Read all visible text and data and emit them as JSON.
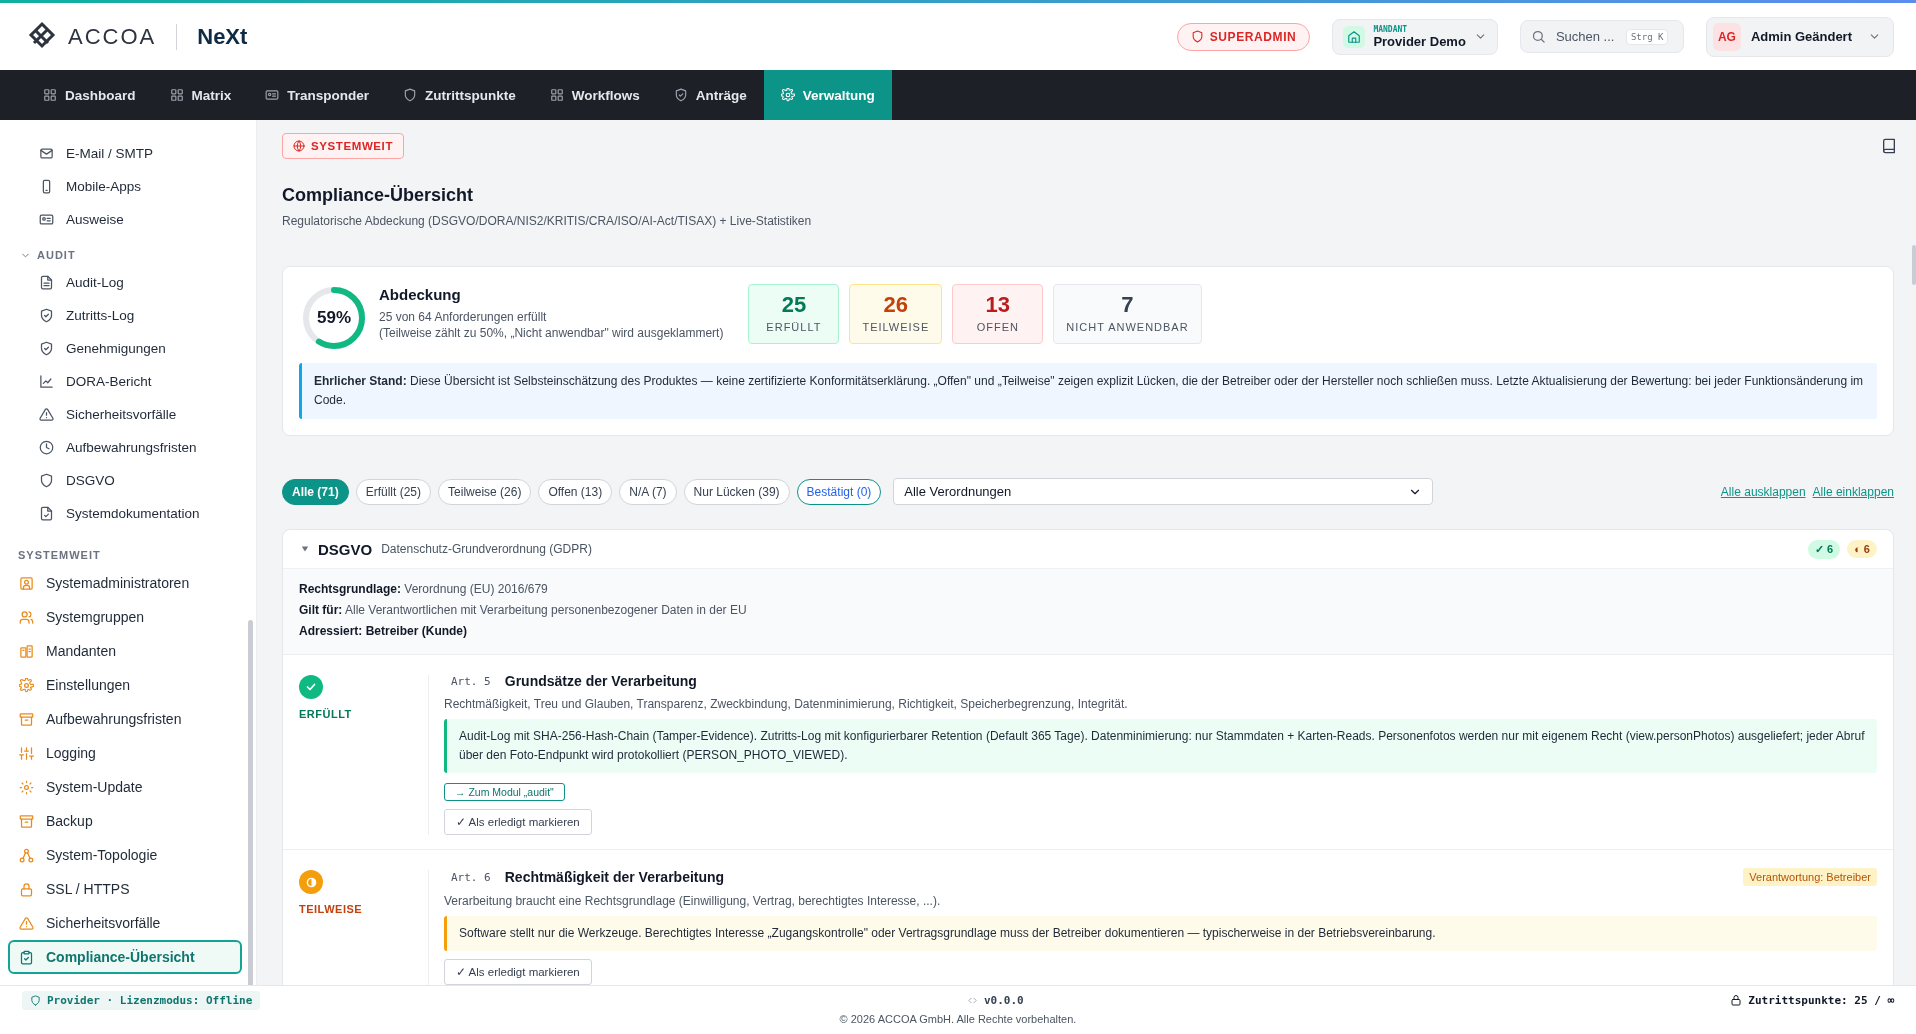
{
  "header": {
    "logo": "ACCOA",
    "product": "NeXt",
    "role_badge": "SUPERADMIN",
    "tenant": {
      "label": "MANDANT",
      "value": "Provider Demo"
    },
    "search": {
      "placeholder": "Suchen ...",
      "shortcut": "Strg K"
    },
    "user": {
      "initials": "AG",
      "name": "Admin Geändert"
    }
  },
  "nav": [
    {
      "label": "Dashboard",
      "selected": false
    },
    {
      "label": "Matrix",
      "selected": false
    },
    {
      "label": "Transponder",
      "selected": false
    },
    {
      "label": "Zutrittspunkte",
      "selected": false
    },
    {
      "label": "Workflows",
      "selected": false
    },
    {
      "label": "Anträge",
      "selected": false
    },
    {
      "label": "Verwaltung",
      "selected": true
    }
  ],
  "sidebar": {
    "groups": [
      {
        "items": [
          {
            "label": "E-Mail / SMTP",
            "selected": false
          },
          {
            "label": "Mobile-Apps",
            "selected": false
          },
          {
            "label": "Ausweise",
            "selected": false
          }
        ]
      },
      {
        "title": "AUDIT",
        "expanded": true,
        "items": [
          {
            "label": "Audit-Log",
            "selected": false
          },
          {
            "label": "Zutritts-Log",
            "selected": false
          },
          {
            "label": "Genehmigungen",
            "selected": false
          },
          {
            "label": "DORA-Bericht",
            "selected": false
          },
          {
            "label": "Sicherheitsvorfälle",
            "selected": false
          },
          {
            "label": "Aufbewahrungsfristen",
            "selected": false
          },
          {
            "label": "DSGVO",
            "selected": false
          },
          {
            "label": "Systemdokumentation",
            "selected": false
          }
        ]
      },
      {
        "title": "SYSTEMWEIT",
        "kind": "system",
        "items": [
          {
            "label": "Systemadministratoren",
            "selected": false
          },
          {
            "label": "Systemgruppen",
            "selected": false
          },
          {
            "label": "Mandanten",
            "selected": false
          },
          {
            "label": "Einstellungen",
            "selected": false
          },
          {
            "label": "Aufbewahrungsfristen",
            "selected": false
          },
          {
            "label": "Logging",
            "selected": false
          },
          {
            "label": "System-Update",
            "selected": false
          },
          {
            "label": "Backup",
            "selected": false
          },
          {
            "label": "System-Topologie",
            "selected": false
          },
          {
            "label": "SSL / HTTPS",
            "selected": false
          },
          {
            "label": "Sicherheitsvorfälle",
            "selected": false
          },
          {
            "label": "Compliance-Übersicht",
            "selected": true
          }
        ]
      }
    ]
  },
  "page": {
    "scope_badge": "SYSTEMWEIT",
    "title": "Compliance-Übersicht",
    "subtitle": "Regulatorische Abdeckung (DSGVO/DORA/NIS2/KRITIS/CRA/ISO/AI-Act/TISAX) + Live-Statistiken"
  },
  "coverage": {
    "percent": "59%",
    "level": 0.59,
    "title": "Abdeckung",
    "line1": "25 von 64 Anforderungen erfüllt",
    "line2": "(Teilweise zählt zu 50%, „Nicht anwendbar\" wird ausgeklammert)",
    "stats": [
      {
        "kind": "fulfilled",
        "value": "25",
        "label": "ERFÜLLT"
      },
      {
        "kind": "partial",
        "value": "26",
        "label": "TEILWEISE"
      },
      {
        "kind": "open",
        "value": "13",
        "label": "OFFEN"
      },
      {
        "kind": "na",
        "value": "7",
        "label": "NICHT ANWENDBAR"
      }
    ],
    "notice": "**Ehrlicher Stand:** Diese Übersicht ist Selbsteinschätzung des Produktes — keine zertifizierte Konformitätserklärung. „Offen\" und „Teilweise\" zeigen explizit Lücken, die der Betreiber oder der Hersteller noch schließen muss. Letzte Aktualisierung der Bewertung: bei jeder Funktionsänderung im Code."
  },
  "filters": [
    {
      "label": "Alle (71)",
      "selected": true,
      "kind": "plain"
    },
    {
      "label": "Erfüllt (25)",
      "selected": false,
      "kind": "plain"
    },
    {
      "label": "Teilweise (26)",
      "selected": false,
      "kind": "plain"
    },
    {
      "label": "Offen (13)",
      "selected": false,
      "kind": "plain"
    },
    {
      "label": "N/A (7)",
      "selected": false,
      "kind": "plain"
    },
    {
      "label": "Nur Lücken (39)",
      "selected": false,
      "kind": "plain"
    },
    {
      "label": "Bestätigt (0)",
      "selected": false,
      "kind": "confirmed"
    }
  ],
  "regulation_select": "Alle Verordnungen",
  "expand_all": "Alle ausklappen",
  "collapse_all": "Alle einklappen",
  "regulation": {
    "code": "DSGVO",
    "name": "Datenschutz-Grundverordnung (GDPR)",
    "expanded": true,
    "counts": [
      {
        "kind": "fulfilled",
        "label": "✓ 6"
      },
      {
        "kind": "partial",
        "label": "◐ 6"
      }
    ],
    "meta": [
      "**Rechtsgrundlage:** Verordnung (EU) 2016/679",
      "**Gilt für:** Alle Verantwortlichen mit Verarbeitung personenbezogener Daten in der EU"
    ],
    "addressed": "Adressiert: Betreiber (Kunde)",
    "articles": [
      {
        "kind": "fulfilled",
        "status_label": "ERFÜLLT",
        "article": "Art. 5",
        "title": "Grundsätze der Verarbeitung",
        "description": "Rechtmäßigkeit, Treu und Glauben, Transparenz, Zweckbindung, Datenminimierung, Richtigkeit, Speicherbegrenzung, Integrität.",
        "evidence": "Audit-Log mit SHA-256-Hash-Chain (Tamper-Evidence). Zutritts-Log mit konfigurierbarer Retention (Default 365 Tage). Datenminimierung: nur Stammdaten + Karten-Reads. Personenfotos werden nur mit eigenem Recht (view.personPhotos) ausgeliefert; jeder Abruf über den Foto-Endpunkt wird protokolliert (PERSON_PHOTO_VIEWED).",
        "module_link": "→ Zum Modul „audit\"",
        "mark_button": "✓ Als erledigt markieren"
      },
      {
        "kind": "partial",
        "status_label": "TEILWEISE",
        "article": "Art. 6",
        "title": "Rechtmäßigkeit der Verarbeitung",
        "responsibility": "Verantwortung: Betreiber",
        "description": "Verarbeitung braucht eine Rechtsgrundlage (Einwilligung, Vertrag, berechtigtes Interesse, ...).",
        "evidence": "Software stellt nur die Werkzeuge. Berechtigtes Interesse „Zugangskontrolle\" oder Vertragsgrundlage muss der Betreiber dokumentieren — typischerweise in der Betriebsvereinbarung.",
        "mark_button": "✓ Als erledigt markieren"
      }
    ]
  },
  "footer": {
    "license": "Provider · Lizenzmodus: Offline",
    "version": "v0.0.0",
    "access_points": "Zutrittspunkte: 25 / ∞",
    "copyright": "© 2026 ACCOA GmbH. Alle Rechte vorbehalten."
  }
}
